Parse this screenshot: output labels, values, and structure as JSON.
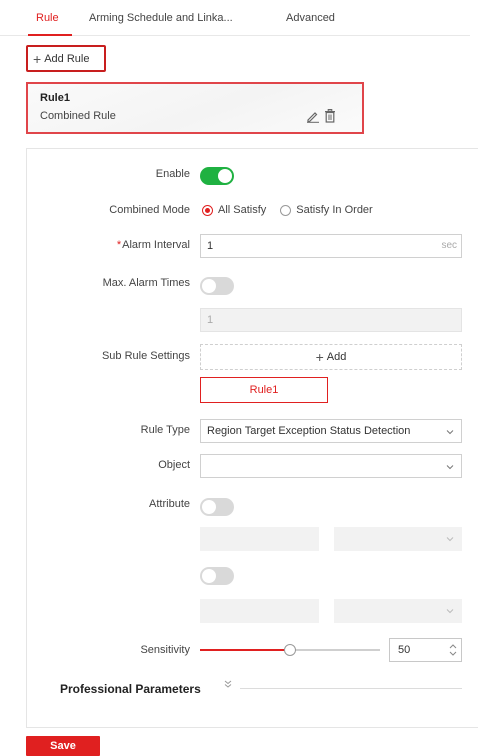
{
  "tabs": [
    {
      "label": "Rule",
      "active": true
    },
    {
      "label": "Arming Schedule and Linka...",
      "active": false
    },
    {
      "label": "Advanced",
      "active": false
    }
  ],
  "add_rule_label": "Add Rule",
  "rule_card": {
    "name": "Rule1",
    "type": "Combined Rule",
    "icons": [
      "edit-icon",
      "delete-icon"
    ]
  },
  "form": {
    "enable": {
      "label": "Enable",
      "value": true
    },
    "combined_mode": {
      "label": "Combined Mode",
      "options": [
        "All Satisfy",
        "Satisfy In Order"
      ],
      "selected": "All Satisfy"
    },
    "alarm_interval": {
      "required_mark": "*",
      "label": "Alarm Interval",
      "value": "1",
      "unit": "sec"
    },
    "max_alarm_times": {
      "label": "Max. Alarm Times",
      "value": false,
      "input_value": "1"
    },
    "sub_rule_settings": {
      "label": "Sub Rule Settings",
      "add_label": "Add",
      "rules": [
        "Rule1"
      ]
    },
    "rule_type": {
      "label": "Rule Type",
      "value": "Region Target Exception Status Detection"
    },
    "object": {
      "label": "Object",
      "value": ""
    },
    "attribute": {
      "label": "Attribute",
      "toggle1": false,
      "toggle2": false
    },
    "sensitivity": {
      "label": "Sensitivity",
      "value": "50",
      "max": 100
    }
  },
  "professional_parameters": "Professional Parameters",
  "save_label": "Save",
  "colors": {
    "accent": "#e02020",
    "toggle_on": "#1fb141",
    "toggle_off": "#d9d9d9"
  }
}
